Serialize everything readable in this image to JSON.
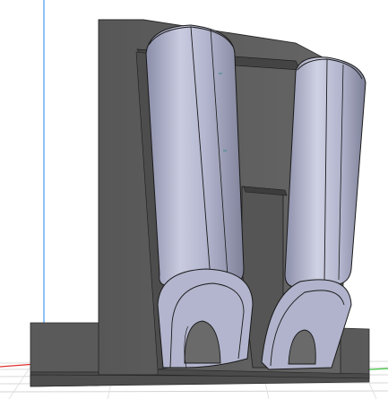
{
  "viewport": {
    "background": "#ffffff",
    "grid_color": "#d4d4d4",
    "x_axis_color": "#e03030",
    "y_axis_color": "#3ec43e",
    "z_axis_color": "#4a9af0"
  },
  "model": {
    "frame_color": "#5d5d5d",
    "frame_dark_color": "#4a4a4a",
    "tube_base_color": "#a8abc6",
    "tube_light_color": "#d2d4e6",
    "tube_shadow_color": "#7d8099",
    "edge_color": "#1a1a1a"
  }
}
